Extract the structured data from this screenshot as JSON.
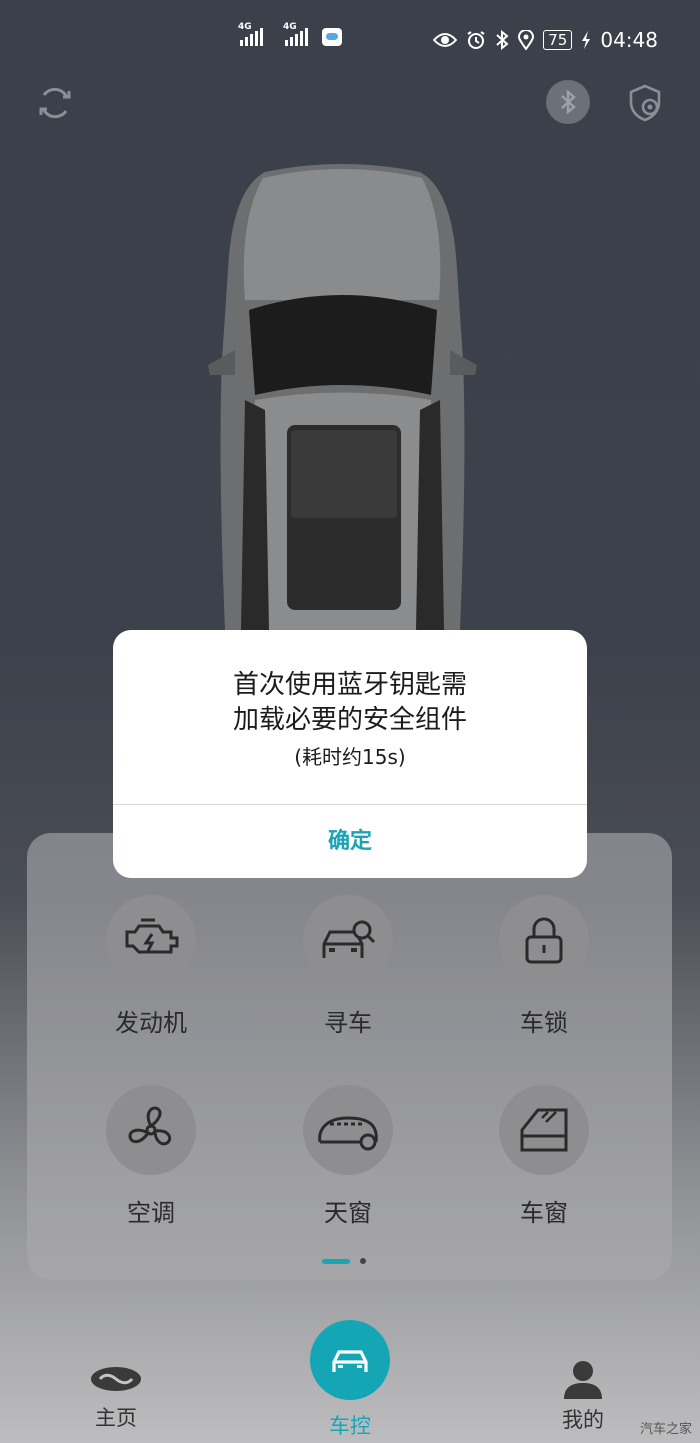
{
  "status_bar": {
    "network_1": "4G",
    "network_2": "4G",
    "battery": "75",
    "time": "04:48",
    "icons": [
      "eye-icon",
      "alarm-icon",
      "bluetooth-icon",
      "location-icon",
      "battery-icon",
      "charging-icon"
    ]
  },
  "top_bar": {
    "icons": [
      "refresh-icon",
      "bluetooth-key-icon",
      "shield-settings-icon"
    ]
  },
  "controls": [
    {
      "label": "发动机",
      "icon": "engine-icon"
    },
    {
      "label": "寻车",
      "icon": "find-car-icon"
    },
    {
      "label": "车锁",
      "icon": "lock-icon"
    },
    {
      "label": "空调",
      "icon": "fan-icon"
    },
    {
      "label": "天窗",
      "icon": "sunroof-icon"
    },
    {
      "label": "车窗",
      "icon": "window-icon"
    }
  ],
  "pager": {
    "pages": 2,
    "current": 1
  },
  "nav": {
    "items": [
      {
        "label": "主页",
        "icon": "brand-logo-icon"
      },
      {
        "label": "车控",
        "icon": "car-icon"
      },
      {
        "label": "我的",
        "icon": "user-icon"
      }
    ],
    "active": "车控"
  },
  "dialog": {
    "line1": "首次使用蓝牙钥匙需",
    "line2": "加载必要的安全组件",
    "sub": "(耗时约15s)",
    "confirm": "确定"
  },
  "watermark": "汽车之家",
  "colors": {
    "accent": "#15a6b6",
    "background": "#3b3f48"
  }
}
